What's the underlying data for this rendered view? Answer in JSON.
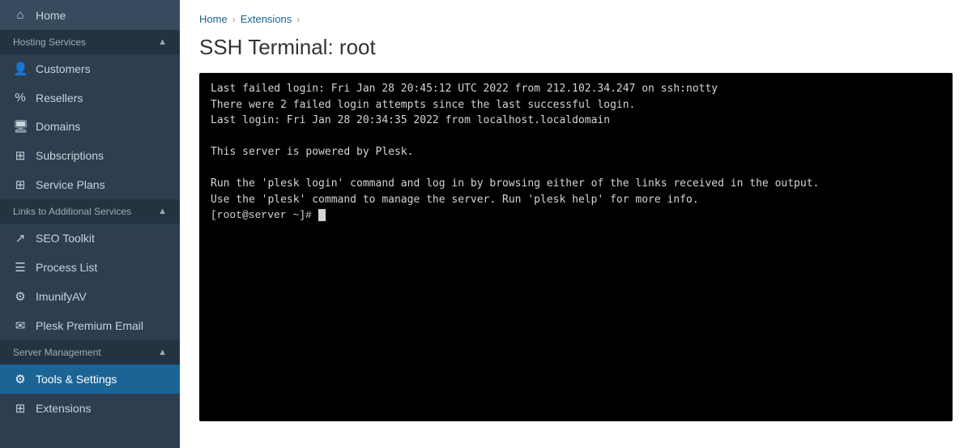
{
  "sidebar": {
    "items": {
      "home": {
        "label": "Home",
        "icon": "⌂"
      },
      "hosting_services": {
        "label": "Hosting Services",
        "icon": "▼",
        "type": "section"
      },
      "customers": {
        "label": "Customers",
        "icon": "👤"
      },
      "resellers": {
        "label": "Resellers",
        "icon": "%"
      },
      "domains": {
        "label": "Domains",
        "icon": "🖥"
      },
      "subscriptions": {
        "label": "Subscriptions",
        "icon": "⊞"
      },
      "service_plans": {
        "label": "Service Plans",
        "icon": "⊞"
      },
      "links_to_additional": {
        "label": "Links to Additional Services",
        "icon": "▼",
        "type": "section"
      },
      "seo_toolkit": {
        "label": "SEO Toolkit",
        "icon": "↗"
      },
      "process_list": {
        "label": "Process List",
        "icon": "☰"
      },
      "imunifyav": {
        "label": "ImunifyAV",
        "icon": "⚙"
      },
      "plesk_premium_email": {
        "label": "Plesk Premium Email",
        "icon": "✉"
      },
      "server_management": {
        "label": "Server Management",
        "icon": "▼",
        "type": "section"
      },
      "tools_settings": {
        "label": "Tools & Settings",
        "icon": "⚙"
      },
      "extensions": {
        "label": "Extensions",
        "icon": "⊞"
      }
    }
  },
  "breadcrumb": {
    "home": "Home",
    "extensions": "Extensions",
    "separator": "›"
  },
  "page": {
    "title": "SSH Terminal: root"
  },
  "terminal": {
    "content_line1": "Last failed login: Fri Jan 28 20:45:12 UTC 2022 from 212.102.34.247 on ssh:notty",
    "content_line2": "There were 2 failed login attempts since the last successful login.",
    "content_line3": "Last login: Fri Jan 28 20:34:35 2022 from localhost.localdomain",
    "content_line4": "",
    "content_line5": "This server is powered by Plesk.",
    "content_line6": "",
    "content_line7": "Run the 'plesk login' command and log in by browsing either of the links received in the output.",
    "content_line8": "Use the 'plesk' command to manage the server. Run 'plesk help' for more info.",
    "content_line9": "",
    "prompt": "[root@server ~]# "
  }
}
